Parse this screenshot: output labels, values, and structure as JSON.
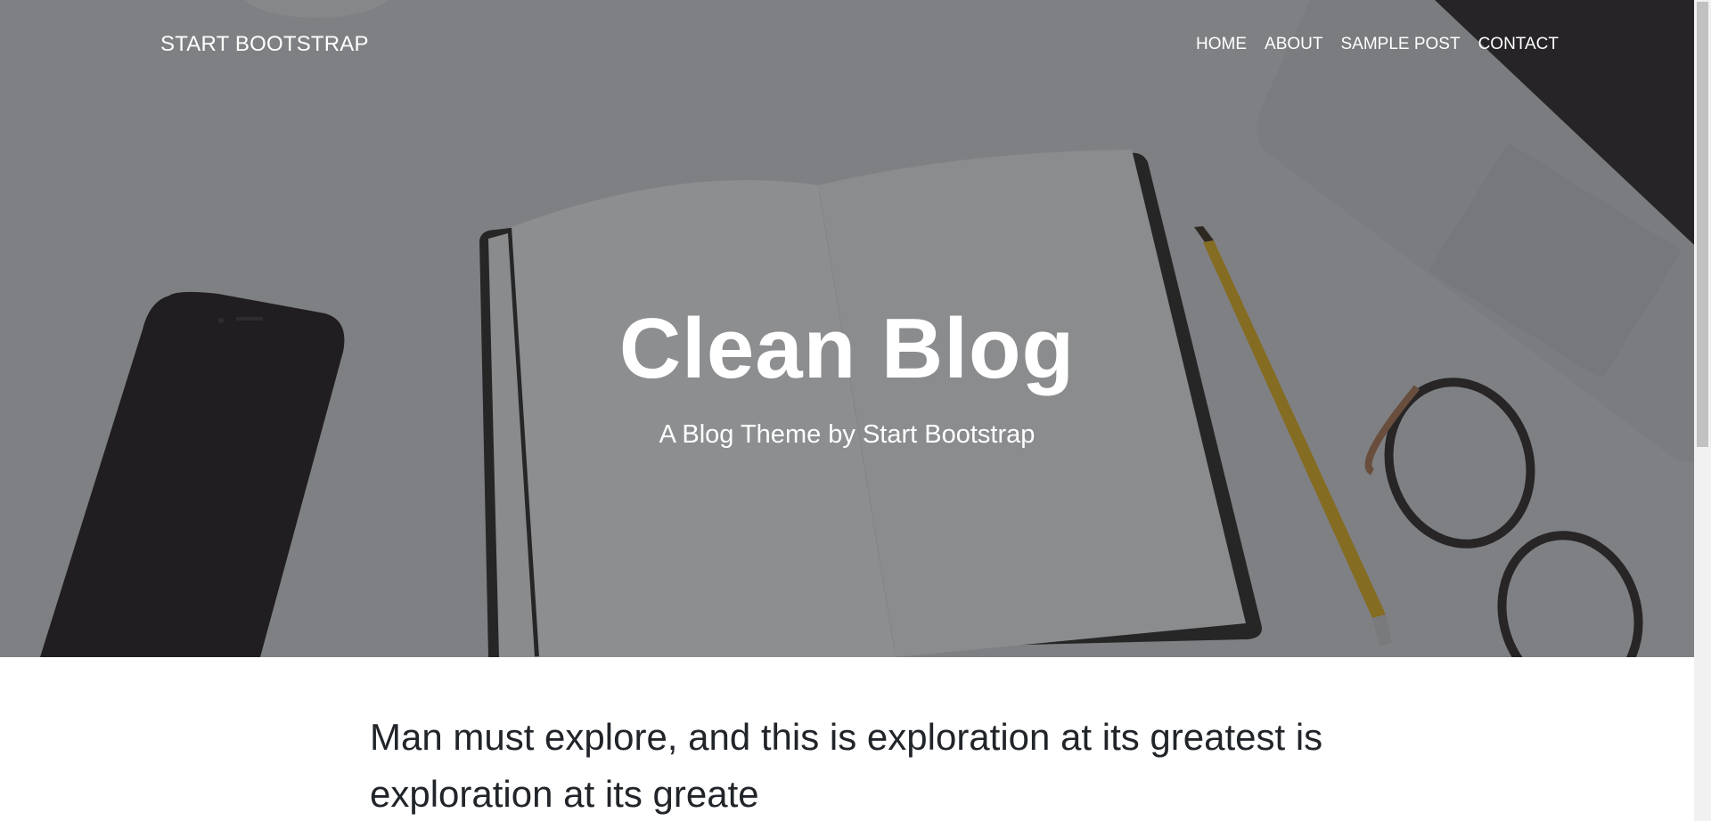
{
  "navbar": {
    "brand": "START BOOTSTRAP",
    "items": [
      {
        "label": "HOME"
      },
      {
        "label": "ABOUT"
      },
      {
        "label": "SAMPLE POST"
      },
      {
        "label": "CONTACT"
      }
    ]
  },
  "hero": {
    "title": "Clean Blog",
    "subtitle": "A Blog Theme by Start Bootstrap"
  },
  "posts": [
    {
      "title": "Man must explore, and this is exploration at its greatest is exploration at its greate"
    }
  ],
  "colors": {
    "overlay": "#212529",
    "text_light": "#ffffff",
    "text_dark": "#212529"
  }
}
